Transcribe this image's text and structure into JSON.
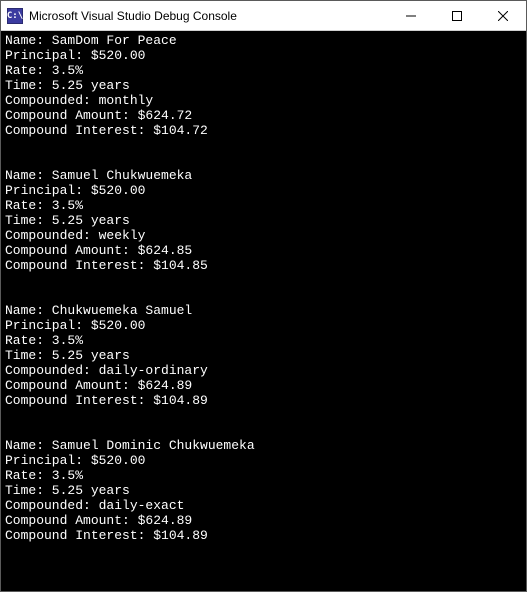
{
  "window": {
    "icon_text": "C:\\",
    "title": "Microsoft Visual Studio Debug Console"
  },
  "labels": {
    "name": "Name: ",
    "principal": "Principal: ",
    "rate": "Rate: ",
    "time": "Time: ",
    "compounded": "Compounded: ",
    "compound_amount": "Compound Amount: ",
    "compound_interest": "Compound Interest: "
  },
  "entries": [
    {
      "name": "SamDom For Peace",
      "principal": "$520.00",
      "rate": "3.5%",
      "time": "5.25 years",
      "compounded": "monthly",
      "compound_amount": "$624.72",
      "compound_interest": "$104.72"
    },
    {
      "name": "Samuel Chukwuemeka",
      "principal": "$520.00",
      "rate": "3.5%",
      "time": "5.25 years",
      "compounded": "weekly",
      "compound_amount": "$624.85",
      "compound_interest": "$104.85"
    },
    {
      "name": "Chukwuemeka Samuel",
      "principal": "$520.00",
      "rate": "3.5%",
      "time": "5.25 years",
      "compounded": "daily-ordinary",
      "compound_amount": "$624.89",
      "compound_interest": "$104.89"
    },
    {
      "name": "Samuel Dominic Chukwuemeka",
      "principal": "$520.00",
      "rate": "3.5%",
      "time": "5.25 years",
      "compounded": "daily-exact",
      "compound_amount": "$624.89",
      "compound_interest": "$104.89"
    }
  ]
}
